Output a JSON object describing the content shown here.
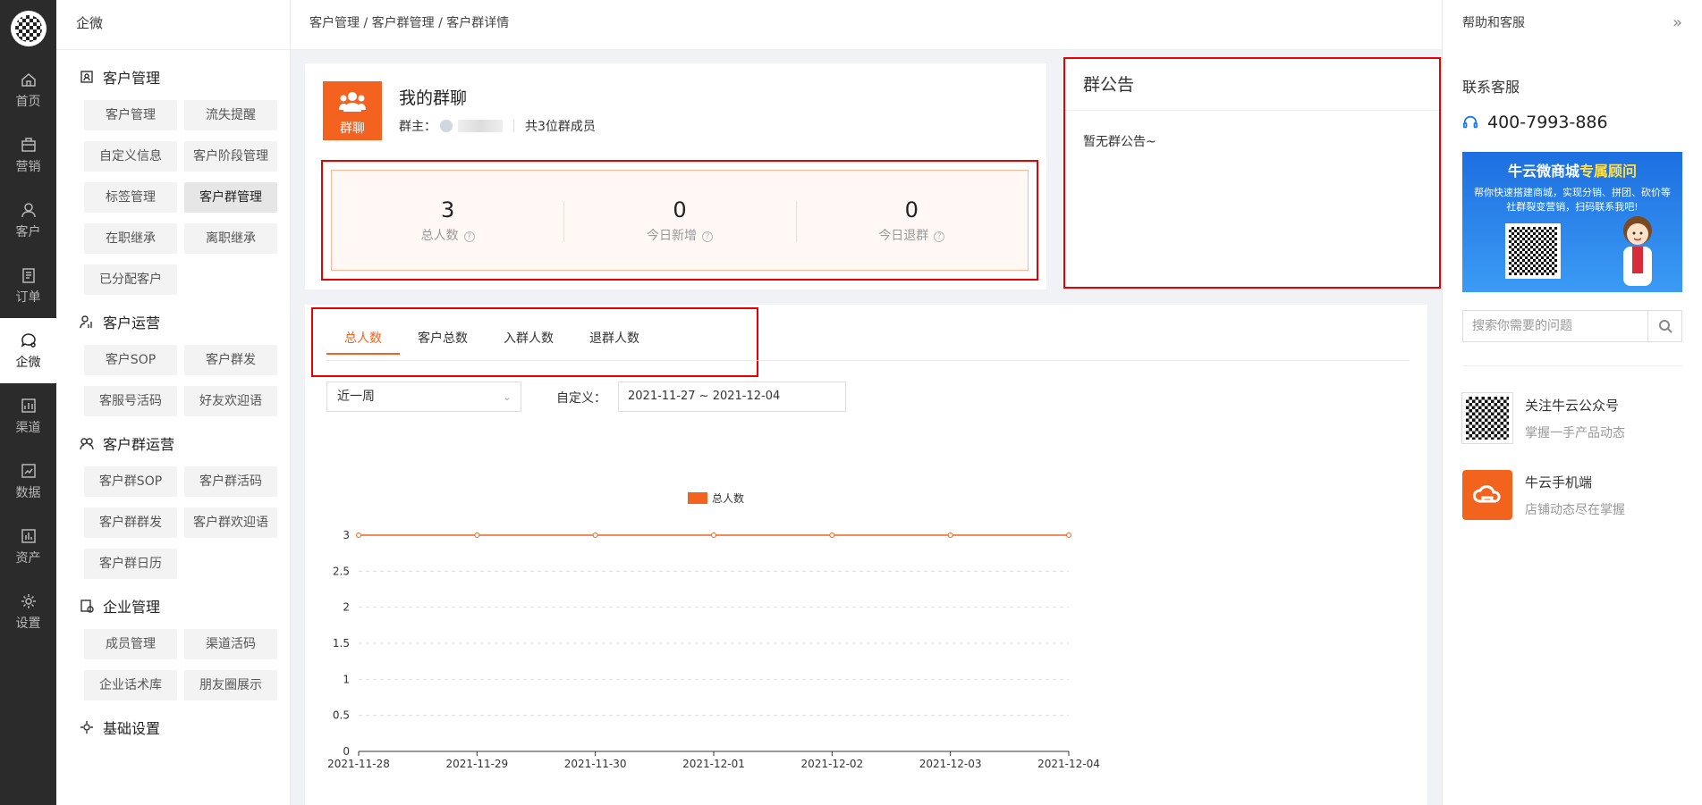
{
  "rail": [
    {
      "label": "首页",
      "icon": "home-icon"
    },
    {
      "label": "营销",
      "icon": "briefcase-icon"
    },
    {
      "label": "客户",
      "icon": "user-icon"
    },
    {
      "label": "订单",
      "icon": "list-icon"
    },
    {
      "label": "企微",
      "icon": "chat-icon",
      "active": true
    },
    {
      "label": "渠道",
      "icon": "channel-icon"
    },
    {
      "label": "数据",
      "icon": "data-icon"
    },
    {
      "label": "资产",
      "icon": "asset-icon"
    },
    {
      "label": "设置",
      "icon": "gear-icon"
    }
  ],
  "sidebar": {
    "title": "企微",
    "groups": [
      {
        "title": "客户管理",
        "items": [
          "客户管理",
          "流失提醒",
          "自定义信息",
          "客户阶段管理",
          "标签管理",
          "客户群管理",
          "在职继承",
          "离职继承",
          "已分配客户"
        ],
        "active": "客户群管理"
      },
      {
        "title": "客户运营",
        "items": [
          "客户SOP",
          "客户群发",
          "客服号活码",
          "好友欢迎语"
        ]
      },
      {
        "title": "客户群运营",
        "items": [
          "客户群SOP",
          "客户群活码",
          "客户群群发",
          "客户群欢迎语",
          "客户群日历"
        ]
      },
      {
        "title": "企业管理",
        "items": [
          "成员管理",
          "渠道活码",
          "企业话术库",
          "朋友圈展示"
        ]
      },
      {
        "title": "基础设置",
        "items": []
      }
    ]
  },
  "breadcrumb": "客户管理 / 客户群管理 / 客户群详情",
  "group": {
    "avatar_label": "群聊",
    "name": "我的群聊",
    "owner_prefix": "群主：",
    "member_count": "共3位群成员"
  },
  "stats": [
    {
      "value": "3",
      "label": "总人数"
    },
    {
      "value": "0",
      "label": "今日新增"
    },
    {
      "value": "0",
      "label": "今日退群"
    }
  ],
  "notice": {
    "title": "群公告",
    "body": "暂无群公告~"
  },
  "tabs": [
    "总人数",
    "客户总数",
    "入群人数",
    "退群人数"
  ],
  "filters": {
    "range": "近一周",
    "custom_label": "自定义：",
    "date_range": "2021-11-27 ~ 2021-12-04"
  },
  "help": {
    "title": "帮助和客服",
    "contact_label": "联系客服",
    "phone": "400-7993-886",
    "banner_title_a": "牛云微商城",
    "banner_title_b": "专属顾问",
    "banner_sub": "帮你快速搭建商城，实现分销、拼团、砍价等社群裂变营销，扫码联系我吧!",
    "search_placeholder": "搜索你需要的问题",
    "links": [
      {
        "title": "关注牛云公众号",
        "sub": "掌握一手产品动态"
      },
      {
        "title": "牛云手机端",
        "sub": "店铺动态尽在掌握"
      }
    ]
  },
  "colors": {
    "accent": "#f4621f",
    "highlight": "#e60000",
    "rail_bg": "#2b2b2b"
  },
  "chart_data": {
    "type": "line",
    "x": [
      "2021-11-28",
      "2021-11-29",
      "2021-11-30",
      "2021-12-01",
      "2021-12-02",
      "2021-12-03",
      "2021-12-04"
    ],
    "series": [
      {
        "name": "总人数",
        "values": [
          3,
          3,
          3,
          3,
          3,
          3,
          3
        ],
        "color": "#f4621f"
      }
    ],
    "ylim": [
      0,
      3
    ],
    "yticks": [
      "0",
      "0.5",
      "1",
      "1.5",
      "2",
      "2.5",
      "3"
    ],
    "grid": true,
    "legend": "top-center"
  }
}
